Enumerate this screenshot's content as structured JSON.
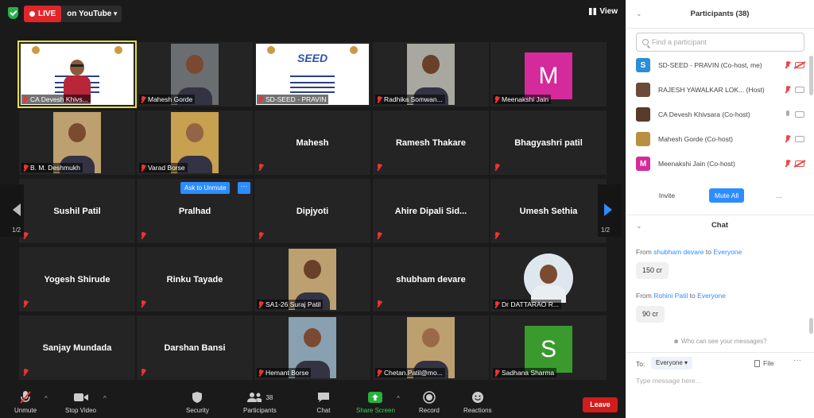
{
  "topbar": {
    "live_label": "LIVE",
    "stream_label": "on YouTube",
    "view_label": "View"
  },
  "tiles": [
    {
      "label": "CA Devesh Khivs...",
      "kind": "poster-cam",
      "active": true
    },
    {
      "label": "Mahesh Gorde",
      "kind": "photo"
    },
    {
      "label": "SD-SEED - PRAVIN",
      "kind": "poster"
    },
    {
      "label": "Radhika Somwan...",
      "kind": "photo"
    },
    {
      "label": "Meenakshi Jain",
      "kind": "avatar",
      "initial": "M",
      "color": "#d42a9c"
    },
    {
      "label": "B. M. Deshmukh",
      "kind": "photo"
    },
    {
      "label": "Varad Borse",
      "kind": "photo"
    },
    {
      "name": "Mahesh",
      "kind": "name"
    },
    {
      "name": "Ramesh Thakare",
      "kind": "name"
    },
    {
      "name": "Bhagyashri patil",
      "kind": "name"
    },
    {
      "name": "Sushil Patil",
      "kind": "name"
    },
    {
      "name": "Pralhad",
      "kind": "name"
    },
    {
      "name": "Dipjyoti",
      "kind": "name"
    },
    {
      "name": "Ahire Dipali Sid...",
      "kind": "name"
    },
    {
      "name": "Umesh Sethia",
      "kind": "name"
    },
    {
      "name": "Yogesh Shirude",
      "kind": "name"
    },
    {
      "name": "Rinku Tayade",
      "kind": "name"
    },
    {
      "label": "SA1-26 Suraj Patil",
      "kind": "photo"
    },
    {
      "name": "shubham devare",
      "kind": "name"
    },
    {
      "label": "Dr DATTARAO R...",
      "kind": "photo-round"
    },
    {
      "name": "Sanjay Mundada",
      "kind": "name"
    },
    {
      "name": "Darshan Bansi",
      "kind": "name"
    },
    {
      "label": "Hemant Borse",
      "kind": "photo"
    },
    {
      "label": "Chetan.Patil@mo...",
      "kind": "photo"
    },
    {
      "label": "Sadhana Sharma",
      "kind": "avatar",
      "initial": "S",
      "color": "#3a9a2e"
    }
  ],
  "poster": {
    "title": "SEED"
  },
  "unmute_prompt": {
    "label": "Ask to Unmute",
    "more": "···"
  },
  "pager": {
    "left": "1/2",
    "right": "1/2"
  },
  "toolbar": {
    "unmute": "Unmute",
    "stop_video": "Stop Video",
    "security": "Security",
    "participants": "Participants",
    "participants_count": "38",
    "chat": "Chat",
    "share_screen": "Share Screen",
    "record": "Record",
    "reactions": "Reactions",
    "leave": "Leave"
  },
  "participants_panel": {
    "title": "Participants (38)",
    "search_placeholder": "Find a participant",
    "rows": [
      {
        "name": "SD-SEED - PRAVIN (Co-host, me)",
        "initial": "S",
        "color": "#2a8fd8",
        "mic": "off",
        "cam": "off"
      },
      {
        "name": "RAJESH  YAWALKAR LOK... (Host)",
        "initial": "",
        "color": "#6b4a3a",
        "mic": "off",
        "cam": "on"
      },
      {
        "name": "CA Devesh Khivsara (Co-host)",
        "initial": "",
        "color": "#5a3a2a",
        "mic": "on",
        "cam": "on"
      },
      {
        "name": "Mahesh Gorde (Co-host)",
        "initial": "",
        "color": "#b89040",
        "mic": "off",
        "cam": "on"
      },
      {
        "name": "Meenakshi Jain (Co-host)",
        "initial": "M",
        "color": "#d42a9c",
        "mic": "off",
        "cam": "off"
      }
    ],
    "invite": "Invite",
    "mute_all": "Mute All",
    "more": "..."
  },
  "chat_panel": {
    "title": "Chat",
    "messages": [
      {
        "from_prefix": "From",
        "sender": "shubham devare",
        "to_word": "to",
        "recipient": "Everyone",
        "text": "150 cr"
      },
      {
        "from_prefix": "From",
        "sender": "Rohini Patil",
        "to_word": "to",
        "recipient": "Everyone",
        "text": "90 cr"
      }
    ],
    "who_can_see": "Who can see your messages?",
    "to_label": "To:",
    "to_value": "Everyone",
    "file_label": "File",
    "more": "···",
    "input_placeholder": "Type message here..."
  }
}
